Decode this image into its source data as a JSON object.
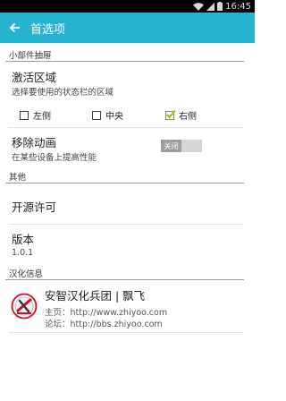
{
  "status_bar": {
    "time": "16:45"
  },
  "app_bar": {
    "title": "首选项"
  },
  "widget_section": {
    "header": "小部件抽屉",
    "activation_area": {
      "title": "激活区域",
      "summary": "选择要使用的状态栏的区域",
      "options": [
        {
          "label": "左侧",
          "checked": false
        },
        {
          "label": "中央",
          "checked": false
        },
        {
          "label": "右侧",
          "checked": true
        }
      ]
    },
    "remove_animation": {
      "title": "移除动画",
      "summary": "在某些设备上提高性能",
      "toggle_label": "关闭",
      "enabled": false
    }
  },
  "other_section": {
    "header": "其他",
    "open_source": {
      "title": "开源许可"
    },
    "version": {
      "title": "版本",
      "value": "1.0.1"
    }
  },
  "localization_section": {
    "header": "汉化信息",
    "team_name": "安智汉化兵团 | 飘飞",
    "homepage": "主页：http://www.zhiyoo.com",
    "forum": "论坛：http://bbs.zhiyoo.com"
  },
  "colors": {
    "accent": "#27b4d0",
    "checkmark": "#9ccc00",
    "status_bar": "#000000"
  }
}
